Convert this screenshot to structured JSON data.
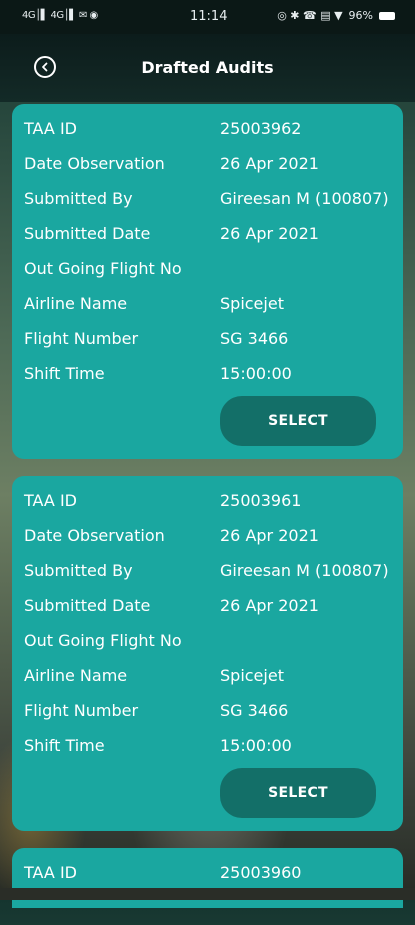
{
  "status_bar": {
    "left_indicators": "4G│▌ 4G│▌ ✉ ◉",
    "time": "11:14",
    "right_indicators": "◎ ✱ ☎ ▤ ▼",
    "battery": "96%"
  },
  "header": {
    "title": "Drafted Audits",
    "back_icon": "chevron-left-circle-icon"
  },
  "labels": {
    "taa_id": "TAA ID",
    "date_observation": "Date Observation",
    "submitted_by": "Submitted By",
    "submitted_date": "Submitted Date",
    "outgoing_flight": "Out Going Flight No",
    "airline_name": "Airline Name",
    "flight_number": "Flight Number",
    "shift_time": "Shift Time",
    "select": "SELECT"
  },
  "audits": [
    {
      "taa_id": "25003962",
      "date_observation": "26 Apr 2021",
      "submitted_by": "Gireesan M (100807)",
      "submitted_date": "26 Apr 2021",
      "outgoing_flight": "",
      "airline_name": "Spicejet",
      "flight_number": "SG 3466",
      "shift_time": "15:00:00"
    },
    {
      "taa_id": "25003961",
      "date_observation": "26 Apr 2021",
      "submitted_by": "Gireesan M (100807)",
      "submitted_date": "26 Apr 2021",
      "outgoing_flight": "",
      "airline_name": "Spicejet",
      "flight_number": "SG 3466",
      "shift_time": "15:00:00"
    },
    {
      "taa_id": "25003960"
    }
  ],
  "colors": {
    "card": "#1aa7a0",
    "button": "#136f68",
    "app_bar": "#0c1c1b"
  }
}
